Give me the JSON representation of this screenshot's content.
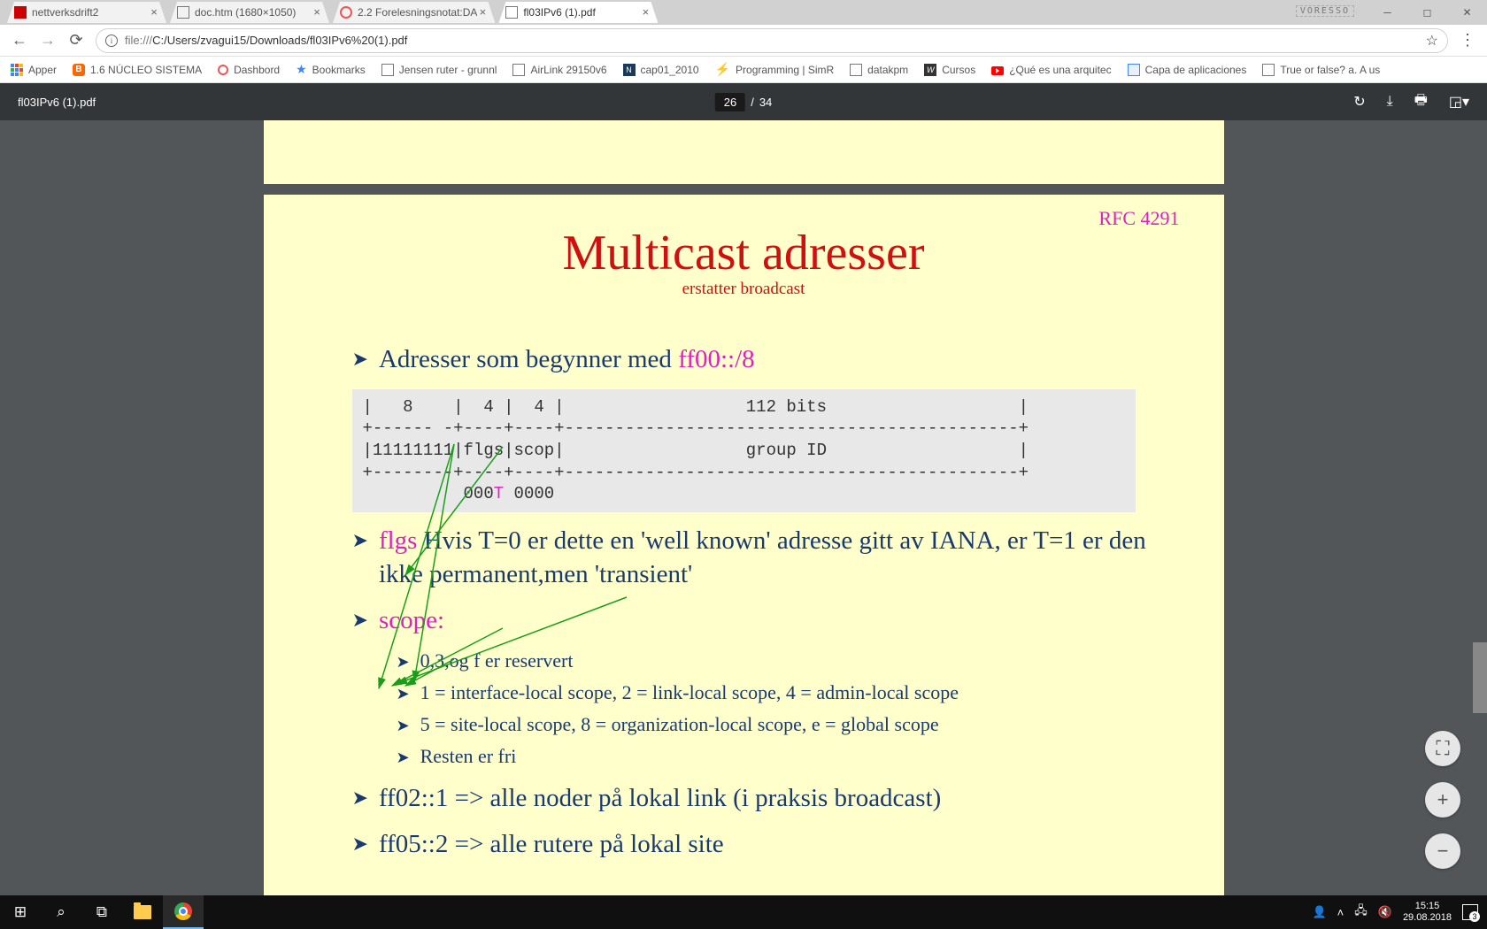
{
  "tabs": [
    {
      "title": "nettverksdrift2"
    },
    {
      "title": "doc.htm (1680×1050)"
    },
    {
      "title": "2.2 Forelesningsnotat:DA"
    },
    {
      "title": "fl03IPv6 (1).pdf"
    }
  ],
  "voresso": "VORESSO",
  "url": {
    "scheme": "file:///",
    "path": "C:/Users/zvagui15/Downloads/fl03IPv6%20(1).pdf"
  },
  "bookmarks": {
    "apps": "Apper",
    "items": [
      "1.6 NÚCLEO SISTEMA",
      "Dashbord",
      "Bookmarks",
      "Jensen ruter - grunnl",
      "AirLink 29150v6",
      "cap01_2010",
      "Programming | SimR",
      "datakpm",
      "Cursos",
      "¿Qué es una arquitec",
      "Capa de aplicaciones",
      "True or false? a. A us"
    ]
  },
  "pdf": {
    "filename": "fl03IPv6 (1).pdf",
    "page_current": "26",
    "page_sep": "/",
    "page_total": "34"
  },
  "slide": {
    "rfc": "RFC 4291",
    "title": "Multicast adresser",
    "subtitle": "erstatter broadcast",
    "bullet1_a": "Adresser som begynner med ",
    "bullet1_b": "ff00::/8",
    "ascii_l1": "|   8    |  4 |  4 |                  112 bits                   |",
    "ascii_l2": "+------ -+----+----+---------------------------------------------+",
    "ascii_l3": "|11111111|flgs|scop|                  group ID                   |",
    "ascii_l4": "+--------+----+----+---------------------------------------------+",
    "ascii_l5a": "          000",
    "ascii_l5t": "T",
    "ascii_l5b": " 0000",
    "bullet2_pink": "flgs",
    "bullet2_rest": " Hvis T=0 er dette en 'well known' adresse gitt av IANA, er T=1 er den ikke permanent,men 'transient'",
    "bullet3": "scope:",
    "sub": [
      "0,3,og f er reservert",
      "1 = interface-local scope, 2 = link-local scope, 4 = admin-local scope",
      "5 = site-local scope, 8 = organization-local scope, e = global scope",
      "Resten er fri"
    ],
    "bullet4_a": "ff02::1  =>  alle noder på lokal link (i praksis broadcast)",
    "bullet5_a": "ff05::2  =>  alle rutere på lokal site"
  },
  "zoom": {
    "fit": "⊕",
    "in": "+",
    "out": "−"
  },
  "taskbar": {
    "time": "15:15",
    "date": "29.08.2018",
    "notif_count": "3"
  }
}
